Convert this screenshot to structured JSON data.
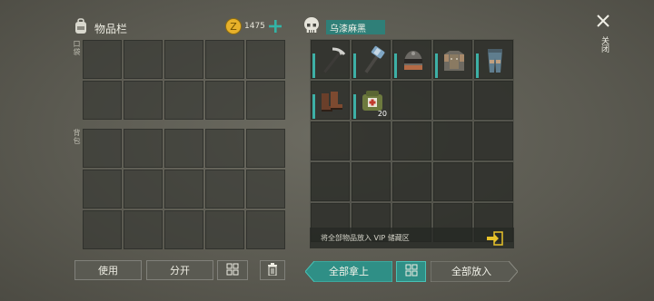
{
  "inventory": {
    "title": "物品栏",
    "coins": "1475",
    "pocket_label": "口袋",
    "backpack_label": "背包"
  },
  "container": {
    "name": "乌漆麻黑",
    "hint": "将全部物品放入 VIP 储藏区",
    "items": [
      {
        "name": "pickaxe",
        "icon": "pickaxe-icon",
        "count": ""
      },
      {
        "name": "hammer",
        "icon": "hammer-icon",
        "count": ""
      },
      {
        "name": "helmet",
        "icon": "helmet-icon",
        "count": ""
      },
      {
        "name": "chest-armor",
        "icon": "chest-armor-icon",
        "count": ""
      },
      {
        "name": "leg-armor",
        "icon": "leg-armor-icon",
        "count": ""
      },
      {
        "name": "boots",
        "icon": "boots-icon",
        "count": ""
      },
      {
        "name": "bag",
        "icon": "bag-icon",
        "count": "20"
      }
    ]
  },
  "buttons": {
    "use": "使用",
    "split": "分开",
    "take_all": "全部拿上",
    "put_all": "全部放入",
    "close": "关闭"
  },
  "colors": {
    "accent": "#3db0a6",
    "coin": "#e7b12a",
    "plus": "#33b3a6"
  }
}
